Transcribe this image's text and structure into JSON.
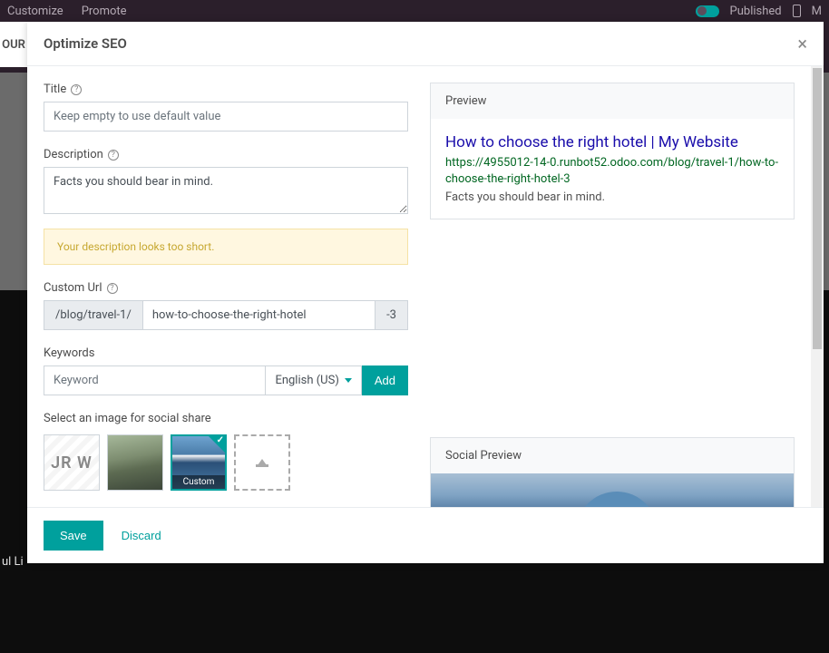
{
  "topbar": {
    "customize": "Customize",
    "promote": "Promote",
    "published": "Published",
    "m": "M"
  },
  "ribbon": "OUR",
  "footer_bg": "ul Li",
  "modal": {
    "title": "Optimize SEO",
    "close": "×"
  },
  "form": {
    "title_label": "Title",
    "title_placeholder": "Keep empty to use default value",
    "title_value": "",
    "description_label": "Description",
    "description_value": "Facts you should bear in mind.",
    "warning": "Your description looks too short.",
    "custom_url_label": "Custom Url",
    "url_prefix": "/blog/travel-1/",
    "url_value": "how-to-choose-the-right-hotel",
    "url_suffix": "-3",
    "keywords_label": "Keywords",
    "keyword_placeholder": "Keyword",
    "keyword_value": "",
    "language": "English (US)",
    "add_btn": "Add",
    "social_label": "Select an image for social share",
    "thumbs": {
      "jr": "JR W",
      "custom_label": "Custom"
    }
  },
  "preview": {
    "heading": "Preview",
    "title": "How to choose the right hotel | My Website",
    "url": "https://4955012-14-0.runbot52.odoo.com/blog/travel-1/how-to-choose-the-right-hotel-3",
    "description": "Facts you should bear in mind."
  },
  "social": {
    "heading": "Social Preview"
  },
  "footer": {
    "save": "Save",
    "discard": "Discard"
  }
}
